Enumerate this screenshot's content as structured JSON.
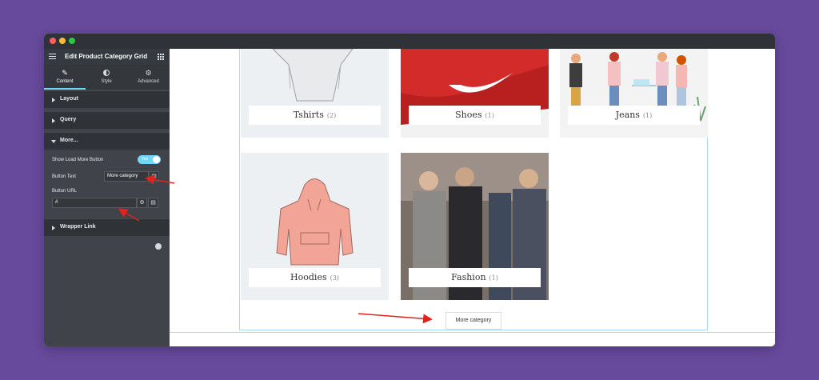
{
  "panel": {
    "title": "Edit Product Category Grid",
    "tabs": [
      {
        "label": "Content"
      },
      {
        "label": "Style"
      },
      {
        "label": "Advanced"
      }
    ],
    "sections": {
      "layout": "Layout",
      "query": "Query",
      "more": "More...",
      "wrapper": "Wrapper Link"
    },
    "controls": {
      "show_load_more_label": "Show Load More Button",
      "toggle_text": "Yes",
      "button_text_label": "Button Text",
      "button_text_value": "More category",
      "button_url_label": "Button URL",
      "button_url_value": "#"
    }
  },
  "grid": {
    "categories": [
      {
        "name": "Tshirts",
        "count": "(2)"
      },
      {
        "name": "Shoes",
        "count": "(1)"
      },
      {
        "name": "Jeans",
        "count": "(1)"
      },
      {
        "name": "Hoodies",
        "count": "(3)"
      },
      {
        "name": "Fashion",
        "count": "(1)"
      }
    ],
    "more_button": "More category"
  },
  "colors": {
    "background": "#674a9c",
    "panel": "#404349",
    "accent": "#71d7f7",
    "arrow": "#e0231c"
  }
}
